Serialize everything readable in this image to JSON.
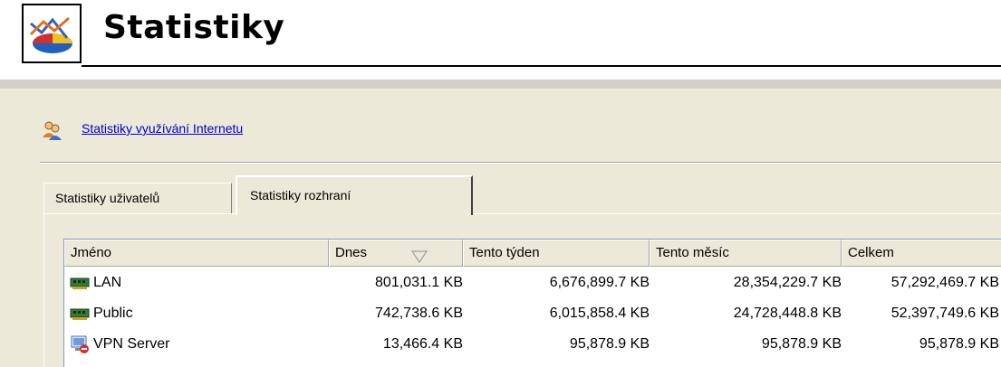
{
  "header": {
    "title": "Statistiky",
    "icon": "statistics-chart-icon"
  },
  "link": {
    "icon": "users-icon",
    "label": "Statistiky využívání Internetu"
  },
  "tabs": [
    {
      "label": "Statistiky uživatelů",
      "active": false
    },
    {
      "label": "Statistiky rozhraní",
      "active": true
    }
  ],
  "table": {
    "columns": [
      "Jméno",
      "Dnes",
      "Tento týden",
      "Tento měsíc",
      "Celkem"
    ],
    "sort_column": "Dnes",
    "sort_icon": "sort-descending-icon",
    "rows": [
      {
        "icon": "network-card-icon",
        "name": "LAN",
        "today": "801,031.1 KB",
        "week": "6,676,899.7 KB",
        "month": "28,354,229.7 KB",
        "total": "57,292,469.7 KB"
      },
      {
        "icon": "network-card-icon",
        "name": "Public",
        "today": "742,738.6 KB",
        "week": "6,015,858.4 KB",
        "month": "24,728,448.8 KB",
        "total": "52,397,749.6 KB"
      },
      {
        "icon": "vpn-server-icon",
        "name": "VPN Server",
        "today": "13,466.4 KB",
        "week": "95,878.9 KB",
        "month": "95,878.9 KB",
        "total": "95,878.9 KB"
      }
    ]
  }
}
